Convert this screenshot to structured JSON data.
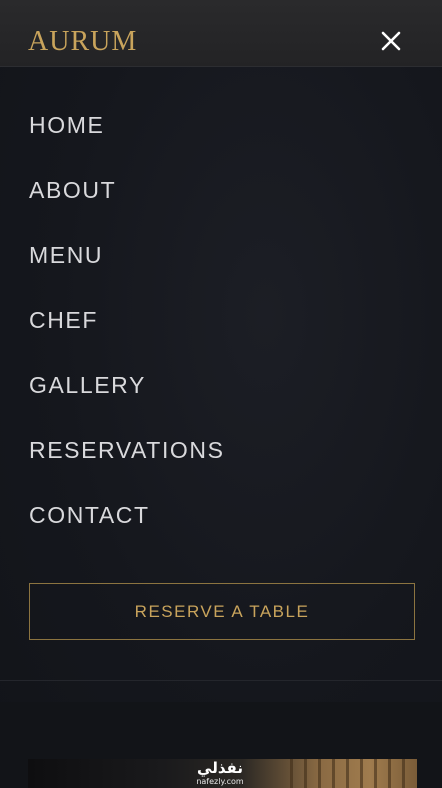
{
  "header": {
    "logo": "AURUM",
    "close_icon": "close-icon"
  },
  "nav": {
    "items": [
      {
        "label": "HOME"
      },
      {
        "label": "ABOUT"
      },
      {
        "label": "MENU"
      },
      {
        "label": "CHEF"
      },
      {
        "label": "GALLERY"
      },
      {
        "label": "RESERVATIONS"
      },
      {
        "label": "CONTACT"
      }
    ]
  },
  "cta": {
    "reserve_label": "RESERVE A TABLE"
  },
  "watermark": {
    "main": "نفذلي",
    "sub": "nafezly.com"
  },
  "colors": {
    "accent_gold": "#c9a45c",
    "background": "#15171d",
    "header_bg": "#262628",
    "nav_text": "#d9d9dc"
  }
}
